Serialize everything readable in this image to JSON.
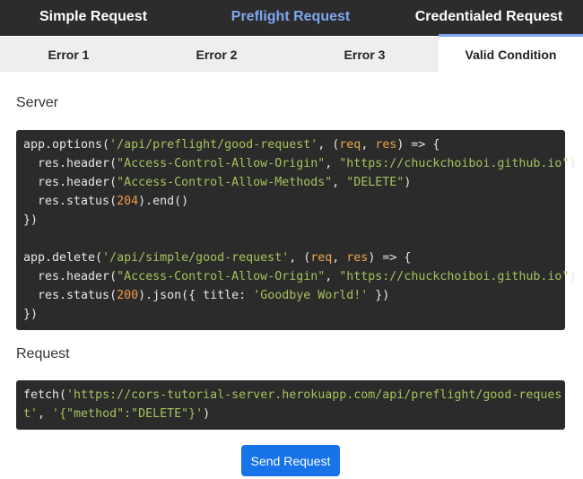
{
  "top_tabs": [
    {
      "label": "Simple Request"
    },
    {
      "label": "Preflight Request"
    },
    {
      "label": "Credentialed Request"
    }
  ],
  "sub_tabs": [
    {
      "label": "Error 1"
    },
    {
      "label": "Error 2"
    },
    {
      "label": "Error 3"
    },
    {
      "label": "Valid Condition"
    }
  ],
  "server": {
    "label": "Server",
    "code": [
      [
        {
          "t": "app.options("
        },
        {
          "t": "'/api/preflight/good-request'",
          "c": "s"
        },
        {
          "t": ", ("
        },
        {
          "t": "req",
          "c": "p"
        },
        {
          "t": ", "
        },
        {
          "t": "res",
          "c": "p"
        },
        {
          "t": ") => {"
        }
      ],
      [
        {
          "t": "  res.header("
        },
        {
          "t": "\"Access-Control-Allow-Origin\"",
          "c": "s"
        },
        {
          "t": ", "
        },
        {
          "t": "\"https://chuckchoiboi.github.io\"",
          "c": "s"
        },
        {
          "t": ")"
        }
      ],
      [
        {
          "t": "  res.header("
        },
        {
          "t": "\"Access-Control-Allow-Methods\"",
          "c": "s"
        },
        {
          "t": ", "
        },
        {
          "t": "\"DELETE\"",
          "c": "s"
        },
        {
          "t": ")"
        }
      ],
      [
        {
          "t": "  res.status("
        },
        {
          "t": "204",
          "c": "n"
        },
        {
          "t": ").end()"
        }
      ],
      [
        {
          "t": "})"
        }
      ],
      [
        {
          "t": ""
        }
      ],
      [
        {
          "t": "app.delete("
        },
        {
          "t": "'/api/simple/good-request'",
          "c": "s"
        },
        {
          "t": ", ("
        },
        {
          "t": "req",
          "c": "p"
        },
        {
          "t": ", "
        },
        {
          "t": "res",
          "c": "p"
        },
        {
          "t": ") => {"
        }
      ],
      [
        {
          "t": "  res.header("
        },
        {
          "t": "\"Access-Control-Allow-Origin\"",
          "c": "s"
        },
        {
          "t": ", "
        },
        {
          "t": "\"https://chuckchoiboi.github.io\"",
          "c": "s"
        },
        {
          "t": ")"
        }
      ],
      [
        {
          "t": "  res.status("
        },
        {
          "t": "200",
          "c": "n"
        },
        {
          "t": ").json({ title: "
        },
        {
          "t": "'Goodbye World!'",
          "c": "s"
        },
        {
          "t": " })"
        }
      ],
      [
        {
          "t": "})"
        }
      ]
    ]
  },
  "request": {
    "label": "Request",
    "code": [
      [
        {
          "t": "fetch("
        },
        {
          "t": "'https://cors-tutorial-server.herokuapp.com/api/preflight/good-reques",
          "c": "s"
        }
      ],
      [
        {
          "t": "t'",
          "c": "s"
        },
        {
          "t": ", "
        },
        {
          "t": "'{\"method\":\"DELETE\"}'",
          "c": "s"
        },
        {
          "t": ")"
        }
      ]
    ]
  },
  "send_button": {
    "label": "Send Request"
  },
  "colors": {
    "nav_bg": "#2c2c2c",
    "active_tab": "#7fa7ef",
    "code_bg": "#2b2b2b",
    "string": "#a5c25c",
    "param": "#e8a54b",
    "number": "#f09a4a",
    "button": "#1673e8"
  }
}
